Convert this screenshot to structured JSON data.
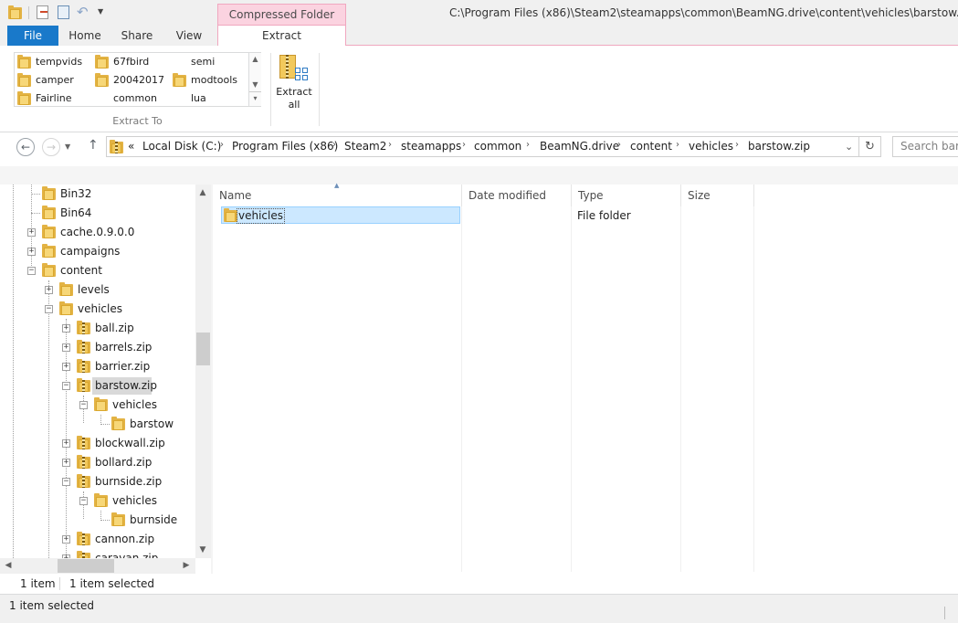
{
  "window": {
    "title": "C:\\Program Files (x86)\\Steam2\\steamapps\\common\\BeamNG.drive\\content\\vehicles\\barstow.zip"
  },
  "ribbon": {
    "context_tab_header": "Compressed Folder Tools",
    "tabs": [
      {
        "label": "File"
      },
      {
        "label": "Home"
      },
      {
        "label": "Share"
      },
      {
        "label": "View"
      },
      {
        "label": "Extract"
      }
    ],
    "extract_to_items": [
      "tempvids",
      "67fbird",
      "semi",
      "camper",
      "20042017",
      "modtools",
      "Fairline",
      "common",
      "lua"
    ],
    "extract_to_label": "Extract To",
    "extract_all_line1": "Extract",
    "extract_all_line2": "all"
  },
  "address": {
    "overflow": "«",
    "crumbs": [
      "Local Disk (C:)",
      "Program Files (x86)",
      "Steam2",
      "steamapps",
      "common",
      "BeamNG.drive",
      "content",
      "vehicles",
      "barstow.zip"
    ],
    "search_placeholder": "Search barstow.zip"
  },
  "tree": {
    "items": [
      {
        "label": "Bin32"
      },
      {
        "label": "Bin64"
      },
      {
        "label": "cache.0.9.0.0"
      },
      {
        "label": "campaigns"
      },
      {
        "label": "content"
      },
      {
        "label": "levels"
      },
      {
        "label": "vehicles"
      },
      {
        "label": "ball.zip"
      },
      {
        "label": "barrels.zip"
      },
      {
        "label": "barrier.zip"
      },
      {
        "label": "barstow.zip"
      },
      {
        "label": "vehicles"
      },
      {
        "label": "barstow"
      },
      {
        "label": "blockwall.zip"
      },
      {
        "label": "bollard.zip"
      },
      {
        "label": "burnside.zip"
      },
      {
        "label": "vehicles"
      },
      {
        "label": "burnside"
      },
      {
        "label": "cannon.zip"
      },
      {
        "label": "caravan.zip"
      }
    ]
  },
  "list": {
    "columns": [
      "Name",
      "Date modified",
      "Type",
      "Size"
    ],
    "rows": [
      {
        "name": "vehicles",
        "date": "",
        "type": "File folder",
        "size": ""
      }
    ]
  },
  "status": {
    "item_count": "1 item",
    "selected": "1 item selected",
    "bottom": "1 item selected"
  },
  "colors": {
    "accent": "#1979ca",
    "context_tab": "#fbd3e0",
    "selection": "#cce8ff"
  }
}
